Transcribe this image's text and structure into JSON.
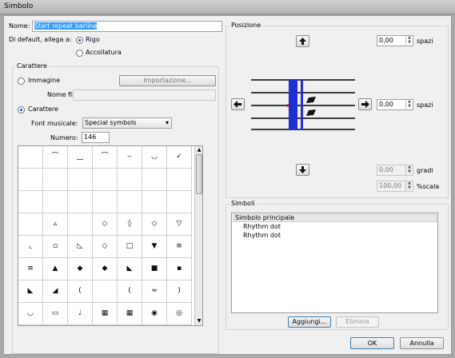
{
  "window": {
    "title": "Simbolo"
  },
  "name_field": {
    "label": "Nome:",
    "value": "Start repeat barline"
  },
  "attach": {
    "label": "Di default, allega a:",
    "options": [
      {
        "label": "Rigo",
        "selected": true
      },
      {
        "label": "Accollatura",
        "selected": false
      }
    ]
  },
  "carattere_group": {
    "title": "Carattere",
    "image_option": {
      "label": "Immagine",
      "selected": false
    },
    "import_button": "Importazione...",
    "filename_label": "Nome file:",
    "filename_value": "",
    "char_option": {
      "label": "Carattere",
      "selected": true
    },
    "font_label": "Font musicale:",
    "font_value": "Special symbols",
    "number_label": "Numero:",
    "number_value": "146"
  },
  "glyph_grid": {
    "columns": 7,
    "rows": 8,
    "cells": [
      "",
      "⌒",
      "‿",
      "⌒",
      "⌣",
      "◡",
      "✓",
      "",
      "",
      "",
      "",
      "",
      "",
      "",
      "",
      "",
      "",
      "",
      "",
      "",
      "",
      "",
      "▵",
      "",
      "◇",
      "◊",
      "◇",
      "▽",
      "⌞",
      "▫",
      "◺",
      "◇",
      "□",
      "▼",
      "≡",
      "≡",
      "▲",
      "◆",
      "◆",
      "◣",
      "■",
      "▪",
      "◣",
      "◢",
      "(",
      "",
      "(",
      "≈",
      ")",
      "◡",
      "▭",
      "♩",
      "▦",
      "▦",
      "◉",
      "◎"
    ]
  },
  "position_group": {
    "title": "Posizione",
    "vertical_value": "0,00",
    "vertical_unit": "spazi",
    "horizontal_value": "0,00",
    "horizontal_unit": "spazi",
    "rotation_value": "0,00",
    "rotation_unit": "gradi",
    "scale_value": "100,00",
    "scale_unit": "%scala",
    "icons": [
      "arrow-up-icon",
      "arrow-down-icon",
      "arrow-left-icon",
      "arrow-right-icon"
    ],
    "barline_color": "#1f2fd6",
    "dot_color": "#111111",
    "anchor_color": "#d01010"
  },
  "symbols_group": {
    "title": "Simboli",
    "items": [
      {
        "label": "Simbolo principale",
        "level": 0
      },
      {
        "label": "Rhythm dot",
        "level": 1
      },
      {
        "label": "Rhythm dot",
        "level": 1
      }
    ],
    "add_button": "Aggiungi...",
    "delete_button": "Elimina"
  },
  "footer": {
    "ok_button": "OK",
    "cancel_button": "Annulla"
  }
}
